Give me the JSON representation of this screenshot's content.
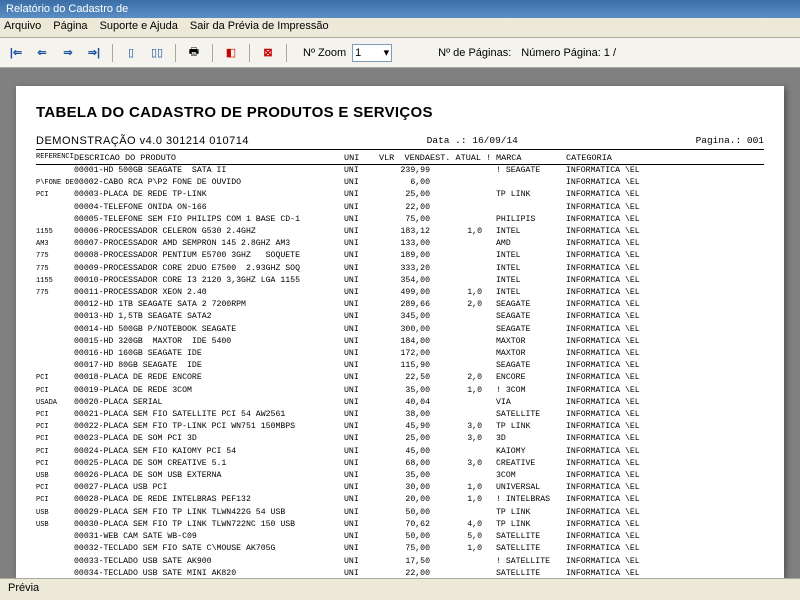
{
  "window": {
    "title": "Relatório do Cadastro de"
  },
  "menu": {
    "arquivo": "Arquivo",
    "pagina": "Página",
    "suporte": "Suporte e Ajuda",
    "sair": "Sair da Prévia de Impressão"
  },
  "toolbar": {
    "zoom_label": "Nº Zoom",
    "zoom_value": "1",
    "pages_label": "Nº de Páginas:",
    "page_num_label": "Número Página: 1 /"
  },
  "report": {
    "title": "TABELA DO CADASTRO DE PRODUTOS E SERVIÇOS",
    "subtitle": "DEMONSTRAÇÃO v4.0 301214 010714",
    "date_label": "Data .: 16/09/14",
    "page_label": "Pagina.: 001",
    "cols": {
      "ref": "REFERENCIA",
      "desc": "DESCRICAO DO PRODUTO",
      "uni": "UNI",
      "vlr": "VLR  VENDA",
      "est": "EST. ATUAL !",
      "marca": "MARCA",
      "cat": "CATEGORIA"
    },
    "rows": [
      {
        "tag": "",
        "desc": "00001-HD 500GB SEAGATE  SATA II",
        "uni": "UNI",
        "vlr": "239,99",
        "est": "",
        "marca": "! SEAGATE",
        "cat": "INFORMATICA \\EL"
      },
      {
        "tag": "P\\FONE DE OUVIDO",
        "desc": "00002-CABO RCA P\\P2 FONE DE OUVIDO",
        "uni": "UNI",
        "vlr": "6,00",
        "est": "",
        "marca": "",
        "cat": "INFORMATICA \\EL"
      },
      {
        "tag": "PCI",
        "desc": "00003-PLACA DE REDE TP-LINK",
        "uni": "UNI",
        "vlr": "25,00",
        "est": "",
        "marca": "TP LINK",
        "cat": "INFORMATICA \\EL"
      },
      {
        "tag": "",
        "desc": "00004-TELEFONE ONIDA ON-166",
        "uni": "UNI",
        "vlr": "22,00",
        "est": "",
        "marca": "",
        "cat": "INFORMATICA \\EL"
      },
      {
        "tag": "",
        "desc": "00005-TELEFONE SEM FIO PHILIPS COM 1 BASE CD-1",
        "uni": "UNI",
        "vlr": "75,00",
        "est": "",
        "marca": "PHILIPIS",
        "cat": "INFORMATICA \\EL"
      },
      {
        "tag": "1155",
        "desc": "00006-PROCESSADOR CELERON G530 2.4GHZ",
        "uni": "UNI",
        "vlr": "183,12",
        "est": "1,0",
        "marca": "INTEL",
        "cat": "INFORMATICA \\EL"
      },
      {
        "tag": "AM3",
        "desc": "00007-PROCESSADOR AMD SEMPRON 145 2.8GHZ AM3",
        "uni": "UNI",
        "vlr": "133,00",
        "est": "",
        "marca": "AMD",
        "cat": "INFORMATICA \\EL"
      },
      {
        "tag": "775",
        "desc": "00008-PROCESSADOR PENTIUM E5700 3GHZ   SOQUETE",
        "uni": "UNI",
        "vlr": "189,00",
        "est": "",
        "marca": "INTEL",
        "cat": "INFORMATICA \\EL"
      },
      {
        "tag": "775",
        "desc": "00009-PROCESSADOR CORE 2DUO E7500  2.93GHZ SOQ",
        "uni": "UNI",
        "vlr": "333,20",
        "est": "",
        "marca": "INTEL",
        "cat": "INFORMATICA \\EL"
      },
      {
        "tag": "1155",
        "desc": "00010-PROCESSADOR CORE I3 2120 3,3GHZ LGA 1155",
        "uni": "UNI",
        "vlr": "354,00",
        "est": "",
        "marca": "INTEL",
        "cat": "INFORMATICA \\EL"
      },
      {
        "tag": "775",
        "desc": "00011-PROCESSADOR XEON 2.40",
        "uni": "UNI",
        "vlr": "499,00",
        "est": "1,0",
        "marca": "INTEL",
        "cat": "INFORMATICA \\EL"
      },
      {
        "tag": "",
        "desc": "00012-HD 1TB SEAGATE SATA 2 7200RPM",
        "uni": "UNI",
        "vlr": "289,66",
        "est": "2,0",
        "marca": "SEAGATE",
        "cat": "INFORMATICA \\EL"
      },
      {
        "tag": "",
        "desc": "00013-HD 1,5TB SEAGATE SATA2",
        "uni": "UNI",
        "vlr": "345,00",
        "est": "",
        "marca": "SEAGATE",
        "cat": "INFORMATICA \\EL"
      },
      {
        "tag": "",
        "desc": "00014-HD 500GB P/NOTEBOOK SEAGATE",
        "uni": "UNI",
        "vlr": "300,00",
        "est": "",
        "marca": "SEAGATE",
        "cat": "INFORMATICA \\EL"
      },
      {
        "tag": "",
        "desc": "00015-HD 320GB  MAXTOR  IDE 5400",
        "uni": "UNI",
        "vlr": "184,00",
        "est": "",
        "marca": "MAXTOR",
        "cat": "INFORMATICA \\EL"
      },
      {
        "tag": "",
        "desc": "00016-HD 160GB SEAGATE IDE",
        "uni": "UNI",
        "vlr": "172,00",
        "est": "",
        "marca": "MAXTOR",
        "cat": "INFORMATICA \\EL"
      },
      {
        "tag": "",
        "desc": "00017-HD 80GB SEAGATE  IDE",
        "uni": "UNI",
        "vlr": "115,90",
        "est": "",
        "marca": "SEAGATE",
        "cat": "INFORMATICA \\EL"
      },
      {
        "tag": "PCI",
        "desc": "00018-PLACA DE REDE ENCORE",
        "uni": "UNI",
        "vlr": "22,50",
        "est": "2,0",
        "marca": "ENCORE",
        "cat": "INFORMATICA \\EL"
      },
      {
        "tag": "PCI",
        "desc": "00019-PLACA DE REDE 3COM",
        "uni": "UNI",
        "vlr": "35,00",
        "est": "1,0",
        "marca": "! 3COM",
        "cat": "INFORMATICA \\EL"
      },
      {
        "tag": "USADA",
        "desc": "00020-PLACA SERIAL",
        "uni": "UNI",
        "vlr": "40,04",
        "est": "",
        "marca": "VIA",
        "cat": "INFORMATICA \\EL"
      },
      {
        "tag": "PCI",
        "desc": "00021-PLACA SEM FIO SATELLITE PCI 54 AW2561",
        "uni": "UNI",
        "vlr": "38,00",
        "est": "",
        "marca": "SATELLITE",
        "cat": "INFORMATICA \\EL"
      },
      {
        "tag": "PCI",
        "desc": "00022-PLACA SEM FIO TP-LINK PCI WN751 150MBPS",
        "uni": "UNI",
        "vlr": "45,90",
        "est": "3,0",
        "marca": "TP LINK",
        "cat": "INFORMATICA \\EL"
      },
      {
        "tag": "PCI",
        "desc": "00023-PLACA DE SOM PCI 3D",
        "uni": "UNI",
        "vlr": "25,00",
        "est": "3,0",
        "marca": "3D",
        "cat": "INFORMATICA \\EL"
      },
      {
        "tag": "PCI",
        "desc": "00024-PLACA SEM FIO KAIOMY PCI 54",
        "uni": "UNI",
        "vlr": "45,00",
        "est": "",
        "marca": "KAIOMY",
        "cat": "INFORMATICA \\EL"
      },
      {
        "tag": "PCI",
        "desc": "00025-PLACA DE SOM CREATIVE 5.1",
        "uni": "UNI",
        "vlr": "68,00",
        "est": "3,0",
        "marca": "CREATIVE",
        "cat": "INFORMATICA \\EL"
      },
      {
        "tag": "USB",
        "desc": "00026-PLACA DE SOM USB EXTERNA",
        "uni": "UNI",
        "vlr": "35,00",
        "est": "",
        "marca": "3COM",
        "cat": "INFORMATICA \\EL"
      },
      {
        "tag": "PCI",
        "desc": "00027-PLACA USB PCI",
        "uni": "UNI",
        "vlr": "30,00",
        "est": "1,0",
        "marca": "UNIVERSAL",
        "cat": "INFORMATICA \\EL"
      },
      {
        "tag": "PCI",
        "desc": "00028-PLACA DE REDE INTELBRAS PEF132",
        "uni": "UNI",
        "vlr": "20,00",
        "est": "1,0",
        "marca": "! INTELBRAS",
        "cat": "INFORMATICA \\EL"
      },
      {
        "tag": "USB",
        "desc": "00029-PLACA SEM FIO TP LINK TLWN422G 54 USB",
        "uni": "UNI",
        "vlr": "50,00",
        "est": "",
        "marca": "TP LINK",
        "cat": "INFORMATICA \\EL"
      },
      {
        "tag": "USB",
        "desc": "00030-PLACA SEM FIO TP LINK TLWN722NC 150 USB",
        "uni": "UNI",
        "vlr": "70,62",
        "est": "4,0",
        "marca": "TP LINK",
        "cat": "INFORMATICA \\EL"
      },
      {
        "tag": "",
        "desc": "00031-WEB CAM SATE WB-C09",
        "uni": "UNI",
        "vlr": "50,00",
        "est": "5,0",
        "marca": "SATELLITE",
        "cat": "INFORMATICA \\EL"
      },
      {
        "tag": "",
        "desc": "00032-TECLADO SEM FIO SATE C\\MOUSE AK705G",
        "uni": "UNI",
        "vlr": "75,00",
        "est": "1,0",
        "marca": "SATELLITE",
        "cat": "INFORMATICA \\EL"
      },
      {
        "tag": "",
        "desc": "00033-TECLADO USB SATE AK900",
        "uni": "UNI",
        "vlr": "17,50",
        "est": "",
        "marca": "! SATELLITE",
        "cat": "INFORMATICA \\EL"
      },
      {
        "tag": "",
        "desc": "00034-TECLADO USB SATE MINI AK820",
        "uni": "UNI",
        "vlr": "22,00",
        "est": "",
        "marca": "SATELLITE",
        "cat": "INFORMATICA \\EL"
      }
    ]
  },
  "status": {
    "text": "Prévia"
  }
}
